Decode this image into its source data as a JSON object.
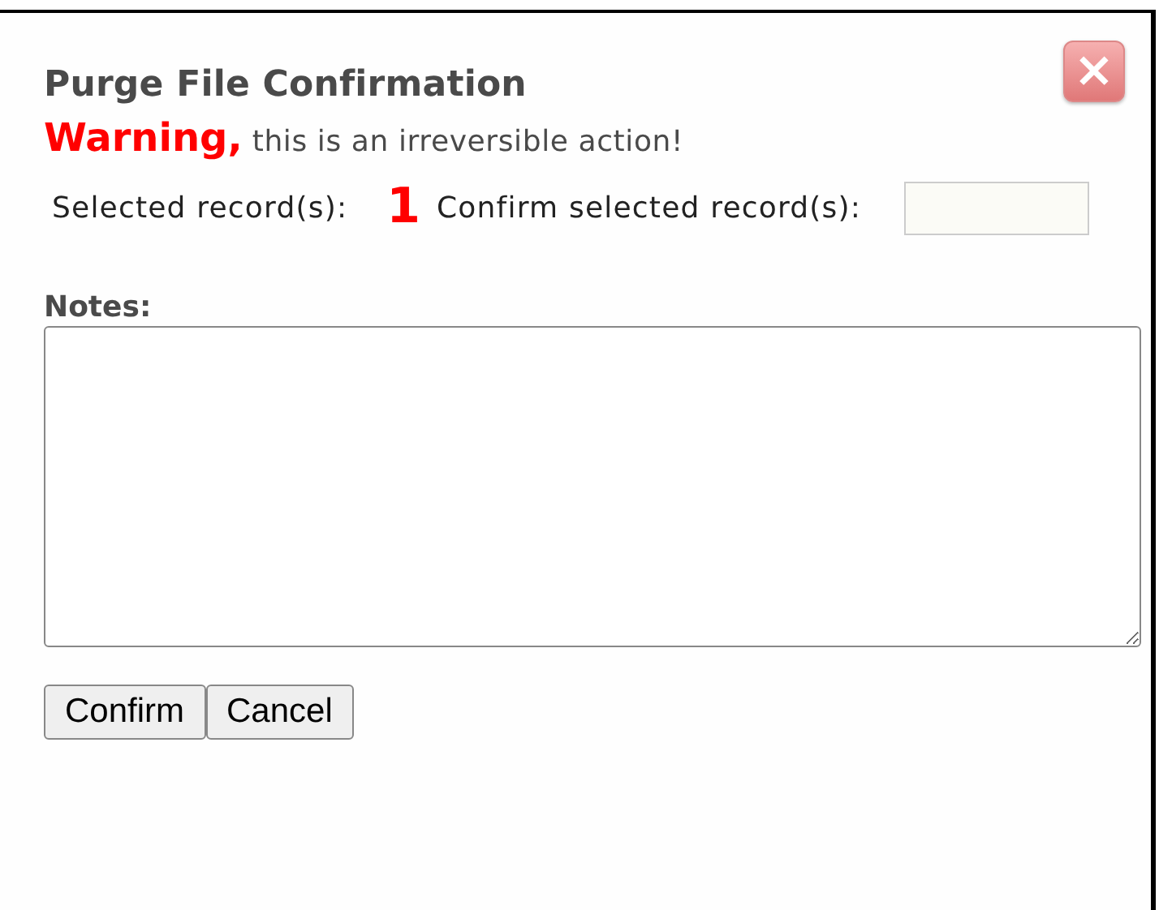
{
  "dialog": {
    "title": "Purge File Confirmation",
    "close_label": "×",
    "warning": {
      "emphasis": "Warning,",
      "message": "this is an irreversible action!"
    },
    "selected_label": "Selected record(s):",
    "selected_count": "1",
    "confirm_label": "Confirm selected record(s):",
    "notes_label": "Notes:",
    "buttons": [
      {
        "label": "Confirm"
      },
      {
        "label": "Cancel"
      }
    ]
  }
}
